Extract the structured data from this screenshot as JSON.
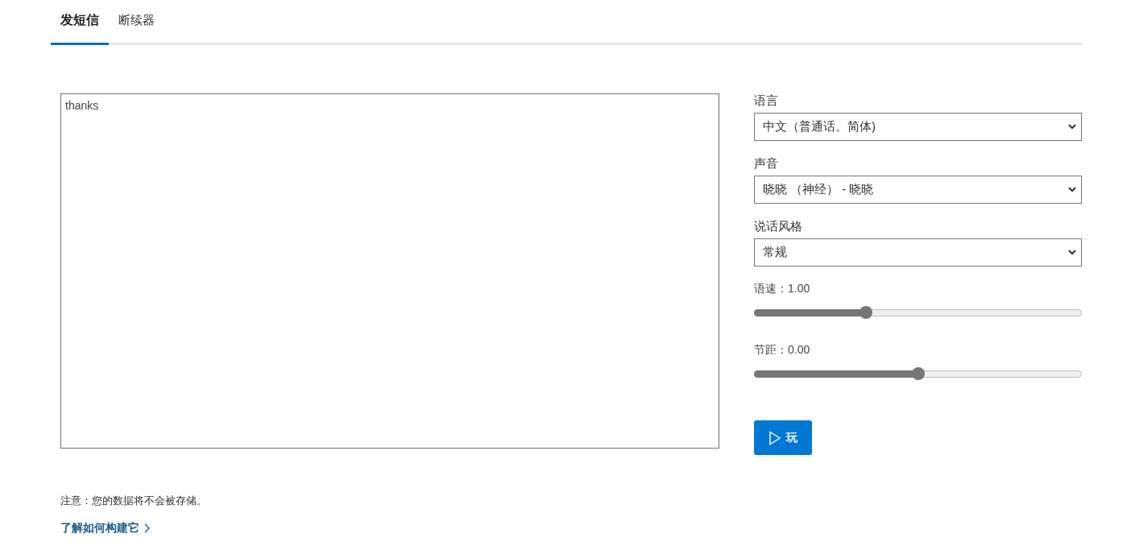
{
  "tabs": [
    {
      "label": "发短信",
      "selected": true
    },
    {
      "label": "断续器",
      "selected": false
    }
  ],
  "text_input": {
    "value": "thanks"
  },
  "settings": [
    {
      "kind": "dropdown",
      "label": "语言",
      "value": "中文（普通话、简体)"
    },
    {
      "kind": "dropdown",
      "label": "声音",
      "value": "晓晓 （神经） - 晓晓"
    },
    {
      "kind": "dropdown",
      "label": "说话风格",
      "value": "常规"
    },
    {
      "kind": "slider",
      "label": "语速：1.00",
      "level": 0.34
    },
    {
      "kind": "slider",
      "label": "节距：0.00",
      "level": 0.5
    }
  ],
  "play_button": {
    "label": "玩"
  },
  "notice": "注意：您的数据将不会被存储。",
  "learn_link": {
    "label": "了解如何构建它"
  }
}
